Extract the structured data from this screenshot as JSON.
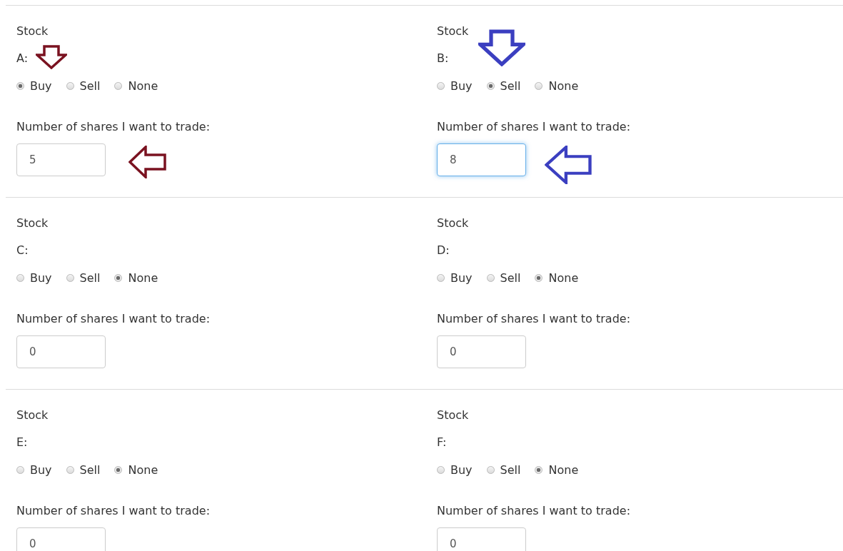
{
  "stocks": [
    {
      "heading": "Stock",
      "label": "A:",
      "options": [
        {
          "label": "Buy",
          "selected": true
        },
        {
          "label": "Sell",
          "selected": false
        },
        {
          "label": "None",
          "selected": false
        }
      ],
      "quantity_label": "Number of shares I want to trade:",
      "quantity": "5",
      "focused": false,
      "markers": [
        {
          "kind": "down",
          "color": "#7a1220"
        },
        {
          "kind": "left",
          "color": "#7a1220"
        }
      ]
    },
    {
      "heading": "Stock",
      "label": "B:",
      "options": [
        {
          "label": "Buy",
          "selected": false
        },
        {
          "label": "Sell",
          "selected": true
        },
        {
          "label": "None",
          "selected": false
        }
      ],
      "quantity_label": "Number of shares I want to trade:",
      "quantity": "8",
      "focused": true,
      "markers": [
        {
          "kind": "down",
          "color": "#3b3fc0"
        },
        {
          "kind": "left",
          "color": "#3b3fc0"
        }
      ]
    },
    {
      "heading": "Stock",
      "label": "C:",
      "options": [
        {
          "label": "Buy",
          "selected": false
        },
        {
          "label": "Sell",
          "selected": false
        },
        {
          "label": "None",
          "selected": true
        }
      ],
      "quantity_label": "Number of shares I want to trade:",
      "quantity": "0",
      "focused": false
    },
    {
      "heading": "Stock",
      "label": "D:",
      "options": [
        {
          "label": "Buy",
          "selected": false
        },
        {
          "label": "Sell",
          "selected": false
        },
        {
          "label": "None",
          "selected": true
        }
      ],
      "quantity_label": "Number of shares I want to trade:",
      "quantity": "0",
      "focused": false
    },
    {
      "heading": "Stock",
      "label": "E:",
      "options": [
        {
          "label": "Buy",
          "selected": false
        },
        {
          "label": "Sell",
          "selected": false
        },
        {
          "label": "None",
          "selected": true
        }
      ],
      "quantity_label": "Number of shares I want to trade:",
      "quantity": "0",
      "focused": false
    },
    {
      "heading": "Stock",
      "label": "F:",
      "options": [
        {
          "label": "Buy",
          "selected": false
        },
        {
          "label": "Sell",
          "selected": false
        },
        {
          "label": "None",
          "selected": true
        }
      ],
      "quantity_label": "Number of shares I want to trade:",
      "quantity": "0",
      "focused": false
    }
  ]
}
